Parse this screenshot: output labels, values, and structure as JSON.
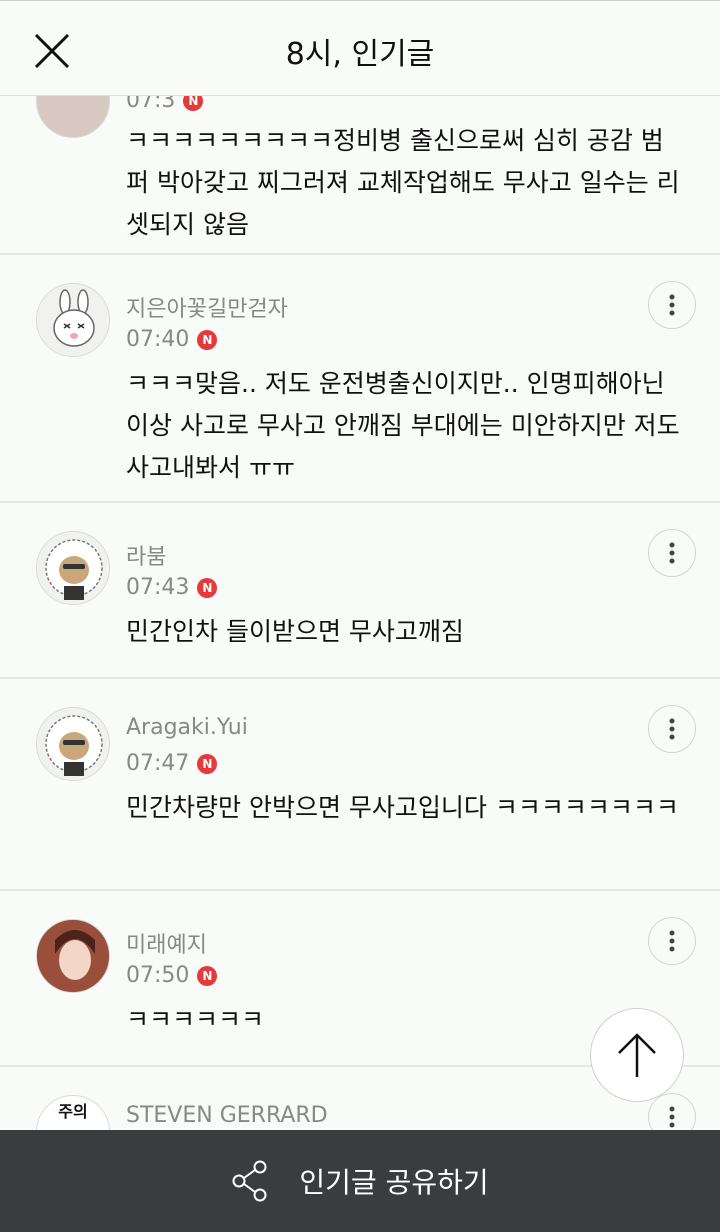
{
  "header": {
    "title": "8시, 인기글"
  },
  "partial_top": {
    "time": "07:3",
    "text": "ㅋㅋㅋㅋㅋㅋㅋㅋㅋ정비병 출신으로써 심히 공감 범퍼 박아갖고 찌그러져 교체작업해도 무사고 일수는 리셋되지 않음"
  },
  "comments": [
    {
      "author": "지은아꽃길만걷자",
      "time": "07:40",
      "badge": "N",
      "text": "ㅋㅋㅋ맞음.. 저도 운전병출신이지만.. 인명피해아닌 이상 사고로 무사고 안깨짐 부대에는 미안하지만 저도 사고내봐서 ㅠㅠ"
    },
    {
      "author": "라붐",
      "time": "07:43",
      "badge": "N",
      "text": "민간인차 들이받으면 무사고깨짐"
    },
    {
      "author": "Aragaki.Yui",
      "time": "07:47",
      "badge": "N",
      "text": "민간차량만 안박으면 무사고입니다 ㅋㅋㅋㅋㅋㅋㅋㅋ"
    },
    {
      "author": "미래예지",
      "time": "07:50",
      "badge": "N",
      "text": "ㅋㅋㅋㅋㅋㅋ"
    },
    {
      "author": "STEVEN GERRARD",
      "avatar_text": "주의"
    }
  ],
  "share": {
    "label": "인기글 공유하기"
  },
  "colors": {
    "badge": "#e5393b",
    "share_bar": "#3a3d40",
    "background": "#f9fbf8"
  }
}
